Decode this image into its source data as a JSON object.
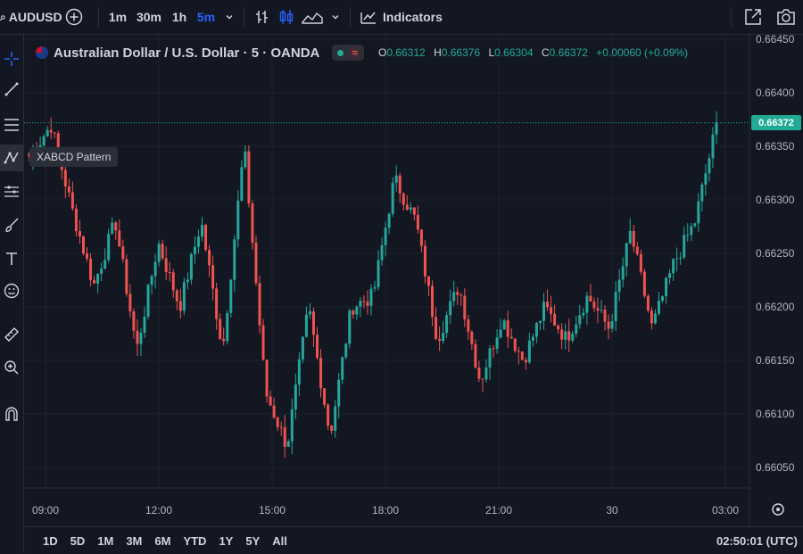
{
  "topbar": {
    "symbol": "AUDUSD",
    "intervals": [
      "1m",
      "30m",
      "1h",
      "5m"
    ],
    "active_interval": "5m",
    "indicators_label": "Indicators"
  },
  "legend": {
    "title": "Australian Dollar / U.S. Dollar · 5 · OANDA",
    "o_label": "O",
    "o_value": "0.66312",
    "h_label": "H",
    "h_value": "0.66376",
    "l_label": "L",
    "l_value": "0.66304",
    "c_label": "C",
    "c_value": "0.66372",
    "change": "+0.00060 (+0.09%)"
  },
  "tooltip": "XABCD Pattern",
  "price_axis": {
    "ticks": [
      "0.66450",
      "0.66400",
      "0.66350",
      "0.66300",
      "0.66250",
      "0.66200",
      "0.66150",
      "0.66100",
      "0.66050"
    ],
    "current_price": "0.66372"
  },
  "time_axis": {
    "ticks": [
      "09:00",
      "12:00",
      "15:00",
      "18:00",
      "21:00",
      "30",
      "03:00"
    ]
  },
  "bottombar": {
    "ranges": [
      "1D",
      "5D",
      "1M",
      "3M",
      "6M",
      "YTD",
      "1Y",
      "5Y",
      "All"
    ],
    "clock": "02:50:01 (UTC)"
  },
  "colors": {
    "up": "#26a69a",
    "down": "#ef5350",
    "accent": "#2962ff",
    "background": "#131722"
  },
  "chart_data": {
    "type": "candlestick",
    "ylim": [
      0.6603,
      0.6646
    ],
    "xlabels": [
      "09:00",
      "12:00",
      "15:00",
      "18:00",
      "21:00",
      "30",
      "03:00"
    ],
    "anchors": [
      0.6634,
      0.6637,
      0.6629,
      0.6622,
      0.6628,
      0.6616,
      0.6626,
      0.662,
      0.6628,
      0.6616,
      0.6635,
      0.6612,
      0.6607,
      0.662,
      0.6608,
      0.662,
      0.6621,
      0.6632,
      0.6628,
      0.6617,
      0.6622,
      0.6613,
      0.6619,
      0.6615,
      0.662,
      0.6617,
      0.6621,
      0.6618,
      0.6627,
      0.6618,
      0.6624,
      0.6628,
      0.6637
    ],
    "last_close": 0.66372
  }
}
